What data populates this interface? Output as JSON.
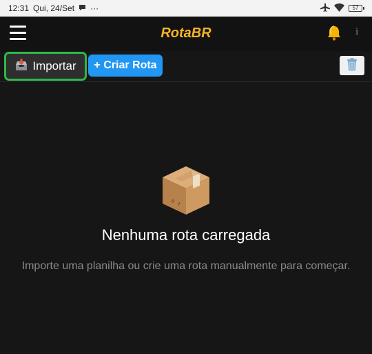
{
  "status_bar": {
    "time": "12:31",
    "date": "Qui, 24/Set",
    "more": "···",
    "battery": "57"
  },
  "app_bar": {
    "title": "RotaBR"
  },
  "toolbar": {
    "import_label": "Importar",
    "create_label": "+ Criar Rota"
  },
  "empty_state": {
    "title": "Nenhuma rota carregada",
    "description": "Importe uma planilha ou crie uma rota manualmente para começar."
  },
  "colors": {
    "brand": "#f4b324",
    "primary": "#2196f3",
    "highlight": "#2fb84a"
  }
}
